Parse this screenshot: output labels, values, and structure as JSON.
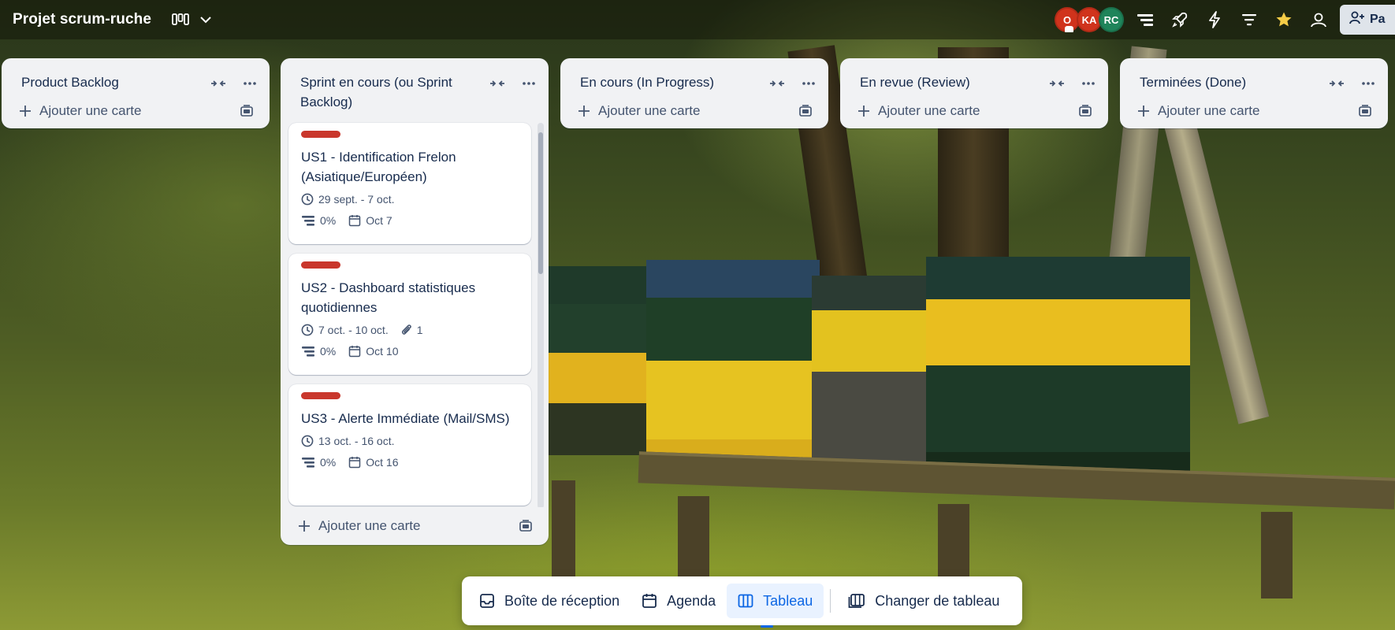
{
  "board": {
    "title": "Projet scrum-ruche",
    "view_icon": "board-view-icon",
    "view_dropdown_icon": "chevron-down-icon"
  },
  "members": [
    {
      "initials": "O",
      "color": "#d0331c"
    },
    {
      "initials": "KA",
      "color": "#d0331c"
    },
    {
      "initials": "RC",
      "color": "#1f845a"
    }
  ],
  "toolbar_icons": [
    "scrum-icon",
    "rocket-icon",
    "automation-icon",
    "filter-icon",
    "star-icon",
    "members-icon"
  ],
  "share": {
    "label": "Pa"
  },
  "colors": {
    "label_red": "#c9372c",
    "accent": "#0c66e4",
    "star": "#f5cd47"
  },
  "lists": [
    {
      "title": "Product Backlog",
      "add_label": "Ajouter une carte",
      "cards": []
    },
    {
      "title": "Sprint en cours (ou Sprint Backlog)",
      "add_label": "Ajouter une carte",
      "cards": [
        {
          "title": "US1 - Identification Frelon (Asiatique/Européen)",
          "dates": "29 sept. - 7 oct.",
          "attachments": null,
          "progress": "0%",
          "due": "Oct 7"
        },
        {
          "title": "US2 - Dashboard statistiques quotidiennes",
          "dates": "7 oct. - 10 oct.",
          "attachments": "1",
          "progress": "0%",
          "due": "Oct 10"
        },
        {
          "title": "US3 - Alerte Immédiate (Mail/SMS)",
          "dates": "13 oct. - 16 oct.",
          "attachments": null,
          "progress": "0%",
          "due": "Oct 16"
        }
      ]
    },
    {
      "title": "En cours (In Progress)",
      "add_label": "Ajouter une carte",
      "cards": []
    },
    {
      "title": "En revue (Review)",
      "add_label": "Ajouter une carte",
      "cards": []
    },
    {
      "title": "Terminées (Done)",
      "add_label": "Ajouter une carte",
      "cards": []
    }
  ],
  "bottom_nav": [
    {
      "label": "Boîte de réception",
      "icon": "inbox-icon",
      "active": false
    },
    {
      "label": "Agenda",
      "icon": "calendar-icon",
      "active": false
    },
    {
      "label": "Tableau",
      "icon": "board-icon",
      "active": true
    },
    {
      "label": "Changer de tableau",
      "icon": "switch-board-icon",
      "active": false
    }
  ]
}
